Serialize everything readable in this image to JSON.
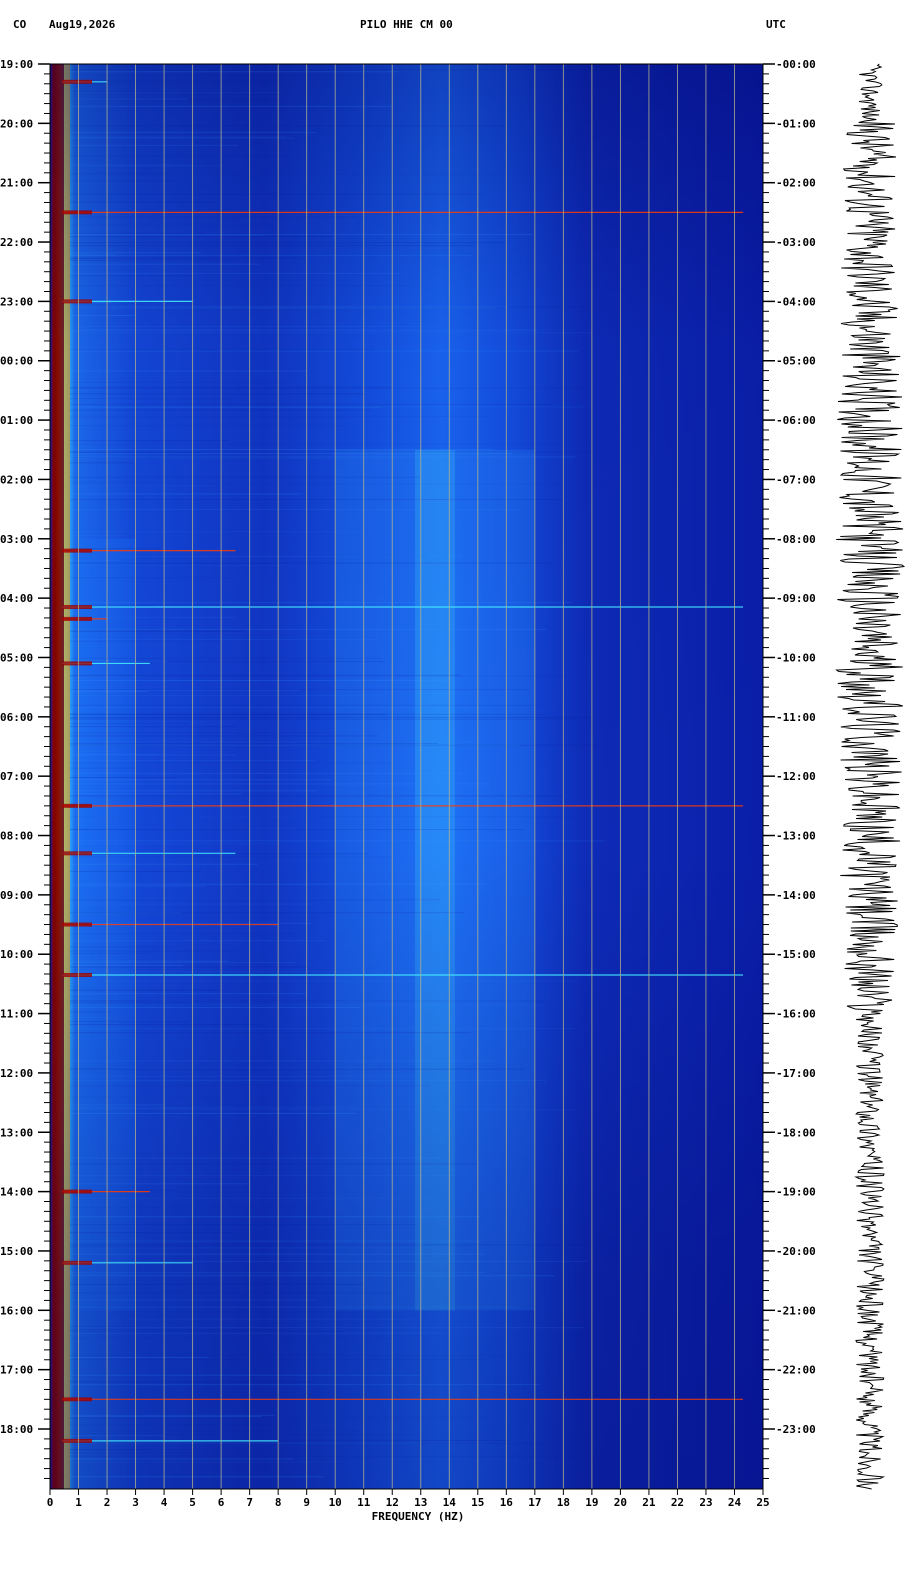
{
  "header": {
    "network": "CO",
    "date": "Aug19,2026",
    "station": "PILO HHE CM 00",
    "timezone": "UTC"
  },
  "colors": {
    "background": "#00189c",
    "grid": "#b4b48c",
    "low": "#0a1aa8",
    "mid": "#1e8cff",
    "high": "#32e6ff",
    "peak": "#a00000",
    "trace": "#000000"
  },
  "chart_data": {
    "type": "heatmap",
    "xlabel": "FREQUENCY (HZ)",
    "xlim": [
      0,
      25
    ],
    "x_ticks": [
      "0",
      "1",
      "2",
      "3",
      "4",
      "5",
      "6",
      "7",
      "8",
      "9",
      "10",
      "11",
      "12",
      "13",
      "14",
      "15",
      "16",
      "17",
      "18",
      "19",
      "20",
      "21",
      "22",
      "23",
      "24",
      "25"
    ],
    "left_time_labels": [
      "19:00",
      "20:00",
      "21:00",
      "22:00",
      "23:00",
      "00:00",
      "01:00",
      "02:00",
      "03:00",
      "04:00",
      "05:00",
      "06:00",
      "07:00",
      "08:00",
      "09:00",
      "10:00",
      "11:00",
      "12:00",
      "13:00",
      "14:00",
      "15:00",
      "16:00",
      "17:00",
      "18:00"
    ],
    "right_time_labels": [
      "00:00",
      "01:00",
      "02:00",
      "03:00",
      "04:00",
      "05:00",
      "06:00",
      "07:00",
      "08:00",
      "09:00",
      "10:00",
      "11:00",
      "12:00",
      "13:00",
      "14:00",
      "15:00",
      "16:00",
      "17:00",
      "18:00",
      "19:00",
      "20:00",
      "21:00",
      "22:00",
      "23:00"
    ],
    "grid": true,
    "energy_bands": [
      {
        "freq_range": [
          0,
          0.6
        ],
        "description": "strong microseism energy",
        "intensity": "peak"
      },
      {
        "freq_range": [
          10,
          17
        ],
        "description": "elevated broadband energy centered near 13.5 Hz",
        "intensity": "high"
      }
    ],
    "event_lines_hours": [
      0.3,
      2.5,
      4.0,
      8.2,
      9.15,
      9.35,
      10.1,
      12.5,
      13.3,
      14.5,
      15.35,
      19.0,
      20.2,
      22.5,
      23.2
    ],
    "seismogram": "continuous trace, larger amplitude from 01:00 to 16:00"
  }
}
